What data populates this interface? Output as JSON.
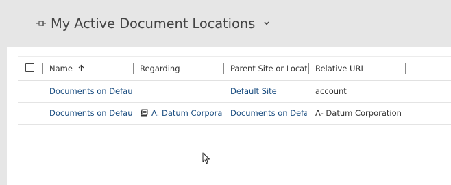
{
  "header": {
    "title": "My Active Document Locations",
    "pin_icon": "pin-icon",
    "chevron_icon": "chevron-down-icon"
  },
  "grid": {
    "columns": [
      {
        "label": "Name",
        "sort": "ascending"
      },
      {
        "label": "Regarding"
      },
      {
        "label": "Parent Site or Locati..."
      },
      {
        "label": "Relative URL"
      }
    ],
    "rows": [
      {
        "name": "Documents on Default...",
        "regarding": "",
        "parent_site": "Default Site",
        "relative_url": "account"
      },
      {
        "name": "Documents on Default...",
        "regarding": "A. Datum Corpora...",
        "regarding_icon": "account-record-icon",
        "parent_site": "Documents on Defa...",
        "relative_url": "A- Datum Corporation (..."
      }
    ]
  },
  "colors": {
    "background": "#e6e6e6",
    "panel": "#ffffff",
    "link": "#1a4d80",
    "text": "#333333",
    "title": "#444444"
  }
}
